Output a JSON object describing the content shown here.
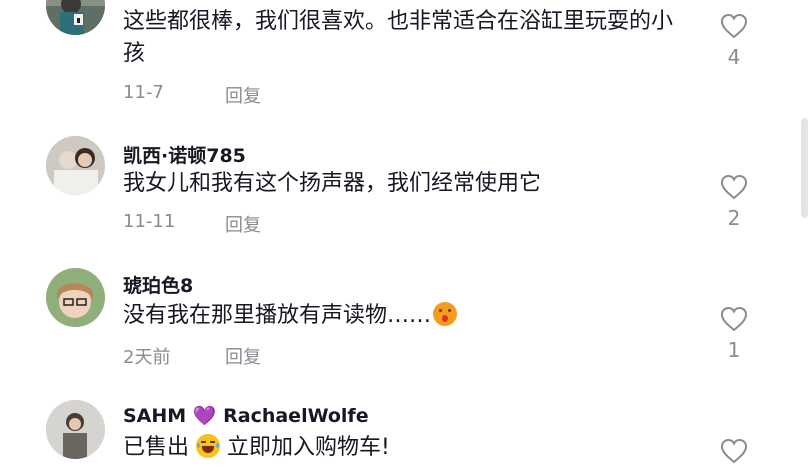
{
  "comments": [
    {
      "username": "",
      "text": "这些都很棒，我们很喜欢。也非常适合在浴缸里玩耍的小孩",
      "date": "11-7",
      "reply_label": "回复",
      "likes": "4"
    },
    {
      "username": "凯西·诺顿785",
      "text": "我女儿和我有这个扬声器，我们经常使用它",
      "date": "11-11",
      "reply_label": "回复",
      "likes": "2"
    },
    {
      "username": "琥珀色8",
      "text": "没有我在那里播放有声读物……",
      "date": "2天前",
      "reply_label": "回复",
      "likes": "1"
    },
    {
      "username_part1": "SAHM",
      "username_heart": "💜",
      "username_part2": "RachaelWolfe",
      "text_part1": "已售出",
      "text_part2": " 立即加入购物车!",
      "date": "",
      "reply_label": "",
      "likes": ""
    }
  ],
  "icons": {
    "like": "heart-outline-icon",
    "emoji_surprised": "surprised-face-emoji",
    "emoji_laughing": "laughing-face-emoji"
  },
  "colors": {
    "text": "#161823",
    "secondary": "#8a8b91",
    "heart_purple": "#8a3bd6"
  }
}
